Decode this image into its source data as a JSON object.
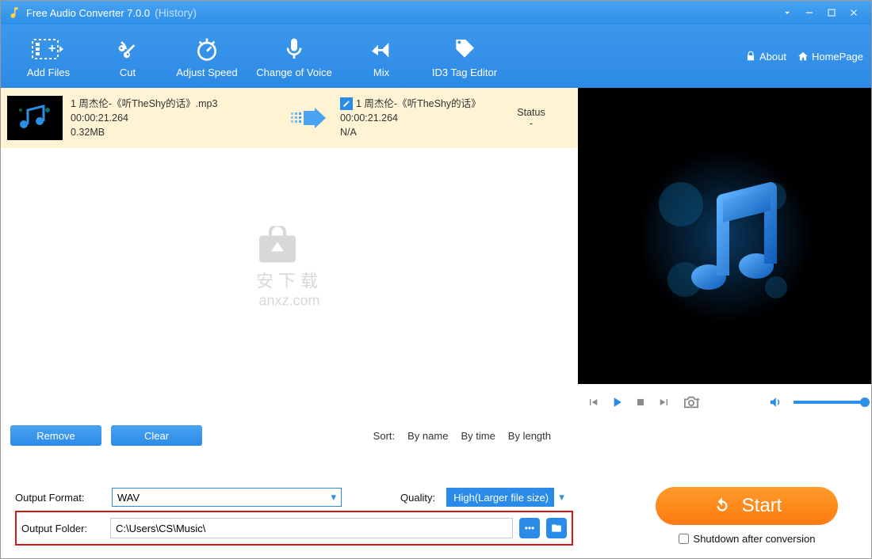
{
  "title": {
    "app": "Free Audio Converter 7.0.0",
    "history": "(History)"
  },
  "toolbar": {
    "add_files": "Add Files",
    "cut": "Cut",
    "adjust_speed": "Adjust Speed",
    "change_of_voice": "Change of Voice",
    "mix": "Mix",
    "id3": "ID3 Tag Editor"
  },
  "topright": {
    "about": "About",
    "homepage": "HomePage"
  },
  "item": {
    "in_name": "1 周杰伦-《听TheShy的话》.mp3",
    "in_time": "00:00:21.264",
    "in_size": "0.32MB",
    "out_name": "1 周杰伦-《听TheShy的话》",
    "out_time": "00:00:21.264",
    "out_na": "N/A",
    "status_label": "Status",
    "status_value": "-"
  },
  "watermark": {
    "line1": "安下载",
    "line2": "anxz.com"
  },
  "actions": {
    "remove": "Remove",
    "clear": "Clear"
  },
  "sort": {
    "label": "Sort:",
    "by_name": "By name",
    "by_time": "By time",
    "by_length": "By length"
  },
  "output": {
    "format_label": "Output Format:",
    "format_value": "WAV",
    "quality_label": "Quality:",
    "quality_value": "High(Larger file size)",
    "folder_label": "Output Folder:",
    "folder_value": "C:\\Users\\CS\\Music\\"
  },
  "start_label": "Start",
  "shutdown_label": "Shutdown after conversion"
}
